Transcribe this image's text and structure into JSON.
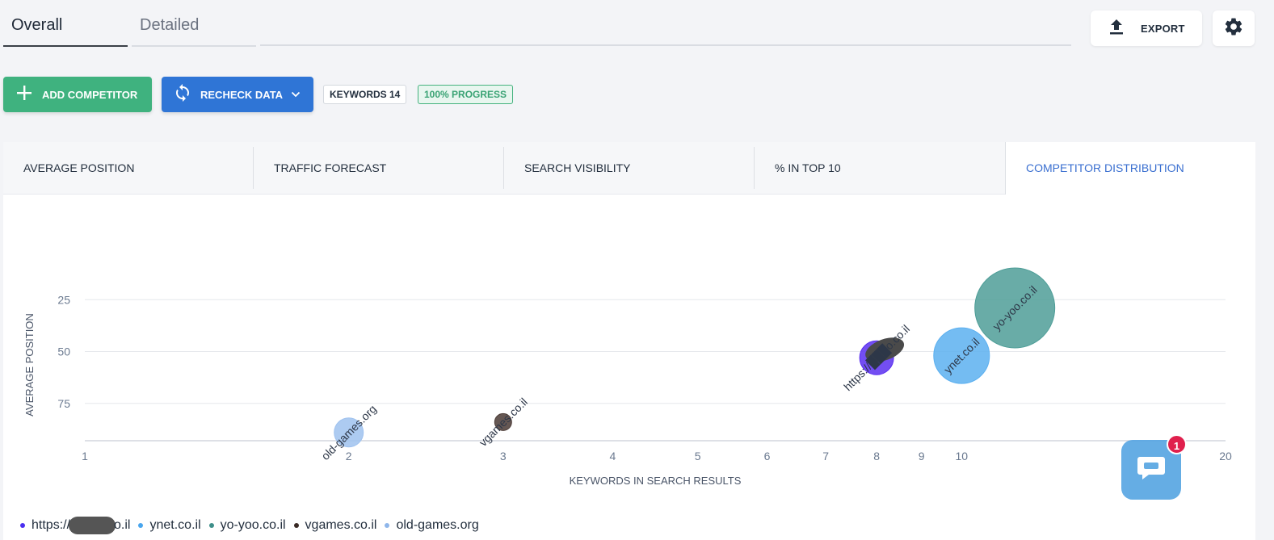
{
  "top_tabs": {
    "overall": "Overall",
    "detailed": "Detailed"
  },
  "toolbar": {
    "export_label": "EXPORT"
  },
  "actions": {
    "add_competitor": "ADD COMPETITOR",
    "recheck_data": "RECHECK DATA",
    "keywords_badge": "KEYWORDS 14",
    "progress_badge": "100% PROGRESS"
  },
  "metric_tabs": [
    {
      "label": "AVERAGE POSITION"
    },
    {
      "label": "TRAFFIC FORECAST"
    },
    {
      "label": "SEARCH VISIBILITY"
    },
    {
      "label": "% IN TOP 10"
    },
    {
      "label": "COMPETITOR DISTRIBUTION"
    }
  ],
  "colors": {
    "accent_blue": "#2f75d6",
    "green": "#3fb27f",
    "active_tab": "#3a6fd0"
  },
  "chart_data": {
    "type": "scatter",
    "xlabel": "KEYWORDS IN SEARCH RESULTS",
    "ylabel": "AVERAGE POSITION",
    "x_scale": "log",
    "x_ticks": [
      "1",
      "2",
      "3",
      "4",
      "5",
      "6",
      "7",
      "8",
      "9",
      "10",
      "20"
    ],
    "y_ticks": [
      "25",
      "50",
      "75"
    ],
    "ylim": [
      100,
      0
    ],
    "series": [
      {
        "name": "https://███o.il",
        "label": "https://███o.co.il",
        "x": 8,
        "y": 53,
        "size": 14,
        "color": "#5a2ff0",
        "redacted": true
      },
      {
        "name": "ynet.co.il",
        "label": "ynet.co.il",
        "x": 10,
        "y": 52,
        "size": 23,
        "color": "#5cb0f0"
      },
      {
        "name": "yo-yoo.co.il",
        "label": "yo-yoo.co.il",
        "x": 11.5,
        "y": 29,
        "size": 33,
        "color": "#4f9e98"
      },
      {
        "name": "vgames.co.il",
        "label": "vgames.co.il",
        "x": 3,
        "y": 84,
        "size": 7,
        "color": "#4a3a35"
      },
      {
        "name": "old-games.org",
        "label": "old-games.org",
        "x": 2,
        "y": 89,
        "size": 12,
        "color": "#9fc2ef"
      }
    ]
  },
  "legend": [
    {
      "prefix": "https://",
      "suffix": "o.il",
      "color": "#4a2ff0",
      "redacted": true
    },
    {
      "text": "ynet.co.il",
      "color": "#49a6ee"
    },
    {
      "text": "yo-yoo.co.il",
      "color": "#3f8f8a"
    },
    {
      "text": "vgames.co.il",
      "color": "#3a2a25"
    },
    {
      "text": "old-games.org",
      "color": "#8fb6ea"
    }
  ],
  "chat": {
    "badge_count": "1"
  }
}
